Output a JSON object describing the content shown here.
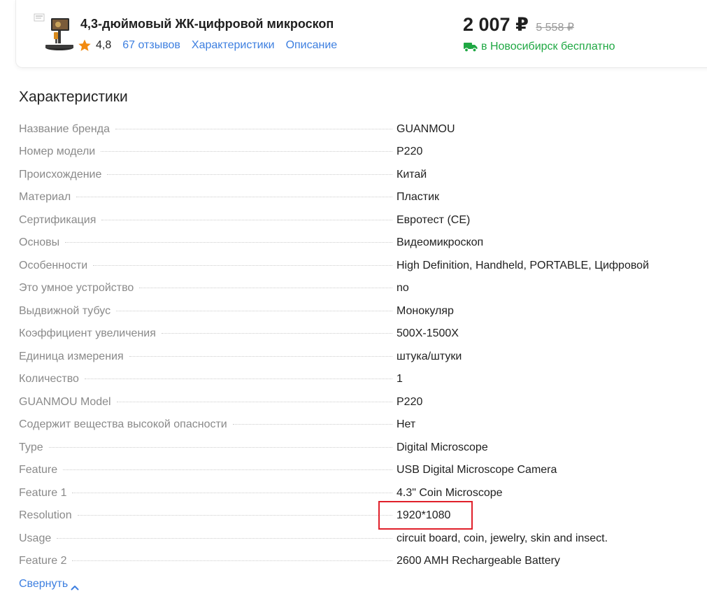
{
  "product": {
    "title": "4,3-дюймовый ЖК-цифровой микроскоп",
    "rating": "4,8",
    "reviews_link": "67 отзывов",
    "specs_link": "Характеристики",
    "description_link": "Описание",
    "price_current": "2 007 ₽",
    "price_old": "5 558 ₽",
    "delivery_text": "в Новосибирск бесплатно",
    "thumbnail_icon": "microscope-thumbnail",
    "rating_icon": "star-icon",
    "delivery_icon": "truck-icon"
  },
  "colors": {
    "link": "#3d7fe0",
    "delivery_green": "#1fa843",
    "star_orange": "#f28a10",
    "highlight_red": "#e0202a"
  },
  "specs": {
    "heading": "Характеристики",
    "rows": [
      {
        "name": "Название бренда",
        "value": "GUANMOU"
      },
      {
        "name": "Номер модели",
        "value": "P220"
      },
      {
        "name": "Происхождение",
        "value": "Китай"
      },
      {
        "name": "Материал",
        "value": "Пластик"
      },
      {
        "name": "Сертификация",
        "value": "Евротест (CE)"
      },
      {
        "name": "Основы",
        "value": "Видеомикроскоп"
      },
      {
        "name": "Особенности",
        "value": "High Definition, Handheld, PORTABLE, Цифровой"
      },
      {
        "name": "Это умное устройство",
        "value": "no"
      },
      {
        "name": "Выдвижной тубус",
        "value": "Монокуляр"
      },
      {
        "name": "Коэффициент увеличения",
        "value": "500X-1500X"
      },
      {
        "name": "Единица измерения",
        "value": "штука/штуки"
      },
      {
        "name": "Количество",
        "value": "1"
      },
      {
        "name": "GUANMOU Model",
        "value": "P220"
      },
      {
        "name": "Содержит вещества высокой опасности",
        "value": "Нет"
      },
      {
        "name": "Type",
        "value": "Digital Microscope"
      },
      {
        "name": "Feature",
        "value": "USB Digital Microscope Camera"
      },
      {
        "name": "Feature 1",
        "value": "4.3\" Coin Microscope"
      },
      {
        "name": "Resolution",
        "value": "1920*1080"
      },
      {
        "name": "Usage",
        "value": "circuit board, coin, jewelry, skin and insect."
      },
      {
        "name": "Feature 2",
        "value": "2600 AMH Rechargeable Battery"
      }
    ],
    "collapse_label": "Свернуть",
    "collapse_icon": "chevron-up-icon"
  }
}
